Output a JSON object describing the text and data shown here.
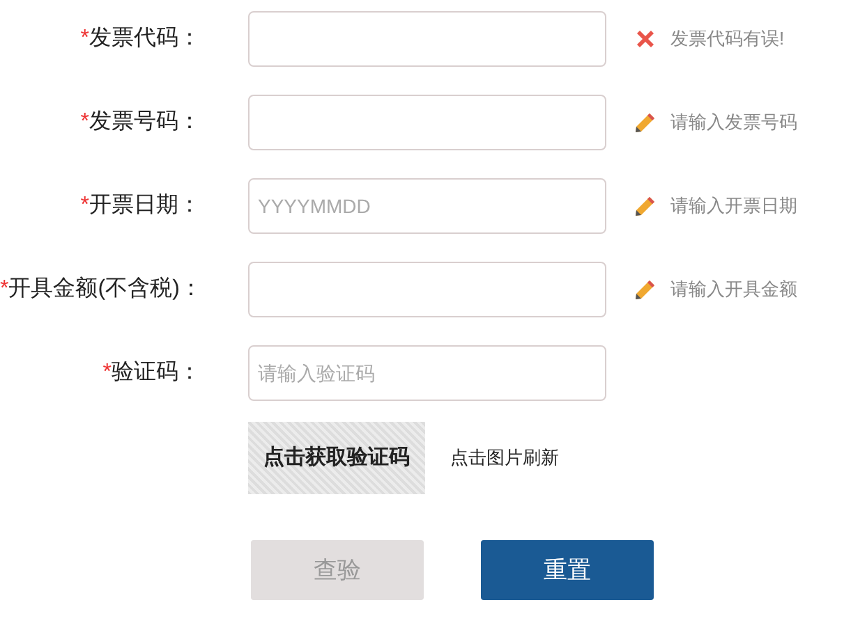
{
  "fields": [
    {
      "label": "发票代码：",
      "required_mark": "*",
      "hint": {
        "kind": "error",
        "text": "发票代码有误!"
      }
    },
    {
      "label": "发票号码：",
      "required_mark": "*",
      "hint": {
        "kind": "edit",
        "text": "请输入发票号码"
      }
    },
    {
      "label": "开票日期：",
      "required_mark": "*",
      "placeholder": "YYYYMMDD",
      "hint": {
        "kind": "edit",
        "text": "请输入开票日期"
      }
    },
    {
      "label": "开具金额(不含税)：",
      "required_mark": "*",
      "hint": {
        "kind": "edit",
        "text": "请输入开具金额"
      }
    },
    {
      "label": "验证码：",
      "required_mark": "*",
      "placeholder": "请输入验证码"
    }
  ],
  "captcha": {
    "image_text": "点击获取验证码",
    "refresh_text": "点击图片刷新"
  },
  "buttons": [
    {
      "label": "查验",
      "disabled": true
    },
    {
      "label": "重置",
      "disabled": false
    }
  ]
}
